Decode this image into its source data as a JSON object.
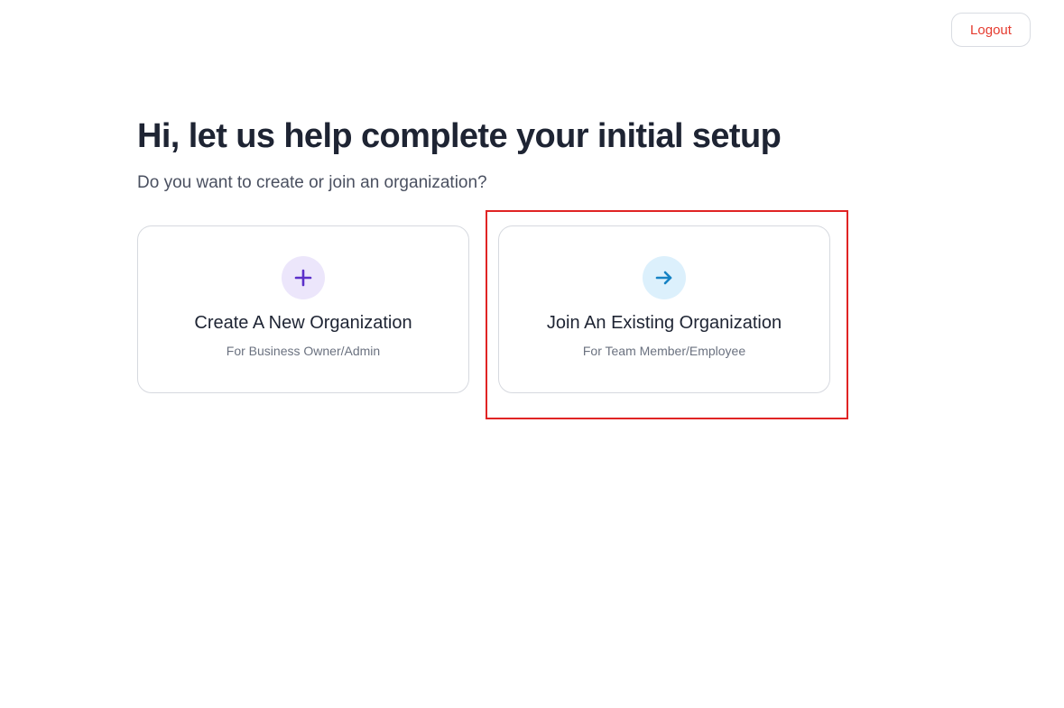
{
  "header": {
    "logout_label": "Logout"
  },
  "main": {
    "title": "Hi, let us help complete your initial setup",
    "subtitle": "Do you want to create or join an organization?",
    "options": [
      {
        "title": "Create A New Organization",
        "subtitle": "For Business Owner/Admin",
        "icon": "plus-icon"
      },
      {
        "title": "Join An Existing Organization",
        "subtitle": "For Team Member/Employee",
        "icon": "arrow-right-icon"
      }
    ]
  },
  "colors": {
    "logout_text": "#e53b2f",
    "plus_icon": "#5b2fc9",
    "plus_icon_bg": "#ece6fb",
    "arrow_icon": "#1582c4",
    "arrow_icon_bg": "#dcf0fc",
    "highlight": "#e02424"
  }
}
